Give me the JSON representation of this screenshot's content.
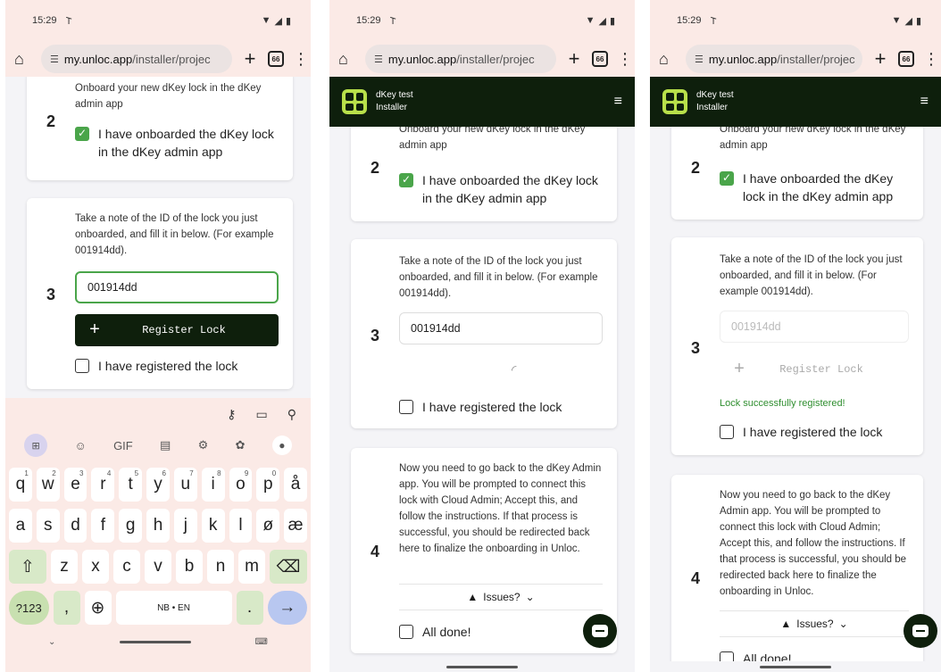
{
  "status": {
    "time": "15:29",
    "app_icon": "antenna-icon",
    "signal": "▾◢",
    "battery": "▮"
  },
  "browser": {
    "url_host": "my.unloc.app",
    "url_path": "/installer/projec",
    "tab_count": "66"
  },
  "app": {
    "title": "dKey test",
    "subtitle": "Installer"
  },
  "step2": {
    "number": "2",
    "desc": "Onboard your new dKey lock in the dKey admin app",
    "check": "I have onboarded the dKey lock in the dKey admin app"
  },
  "step3": {
    "number": "3",
    "desc": "Take a note of the ID of the lock you just onboarded, and fill it in below. (For example 001914dd).",
    "value": "001914dd",
    "button": "Register Lock",
    "check": "I have registered the lock",
    "success": "Lock successfully registered!"
  },
  "step4": {
    "number": "4",
    "desc": "Now you need to go back to the dKey Admin app. You will be prompted to connect this lock with Cloud Admin; Accept this, and follow the instructions. If that process is successful, you should be redirected back here to finalize the onboarding in Unloc.",
    "issues": "Issues?",
    "check": "All done!",
    "check_cut": "All done!"
  },
  "keyboard": {
    "tools": [
      "GIF"
    ],
    "row1": [
      [
        "q",
        "1"
      ],
      [
        "w",
        "2"
      ],
      [
        "e",
        "3"
      ],
      [
        "r",
        "4"
      ],
      [
        "t",
        "5"
      ],
      [
        "y",
        "6"
      ],
      [
        "u",
        "7"
      ],
      [
        "i",
        "8"
      ],
      [
        "o",
        "9"
      ],
      [
        "p",
        "0"
      ],
      [
        "å",
        ""
      ]
    ],
    "row2": [
      "a",
      "s",
      "d",
      "f",
      "g",
      "h",
      "j",
      "k",
      "l",
      "ø",
      "æ"
    ],
    "row3": [
      "z",
      "x",
      "c",
      "v",
      "b",
      "n",
      "m"
    ],
    "num": "?123",
    "space": "NB • EN",
    "comma": ",",
    "period": "."
  }
}
